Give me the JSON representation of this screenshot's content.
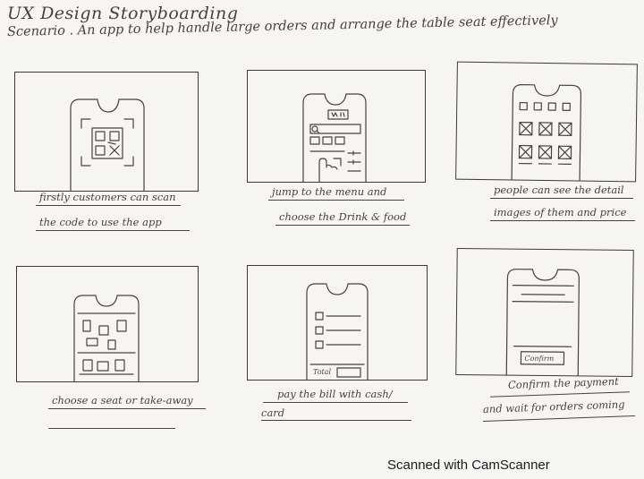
{
  "header": {
    "title": "UX Design Storyboarding",
    "scenario": "Scenario . An app to help handle large orders and arrange the table seat effectively"
  },
  "panels": [
    {
      "caption_line1": "firstly customers can scan",
      "caption_line2": "the code to use the app"
    },
    {
      "caption_line1": "jump to the menu and",
      "caption_line2": "choose the Drink & food"
    },
    {
      "caption_line1": "people can see the detail",
      "caption_line2": "images of them and price"
    },
    {
      "caption_line1": "choose a seat or take-away",
      "caption_line2": ""
    },
    {
      "caption_line1": "pay the bill with cash/",
      "caption_line2": "card",
      "sketch_label": "Total"
    },
    {
      "caption_line1": "Confirm the payment",
      "caption_line2": "and wait for orders coming",
      "sketch_label": "Confirm"
    }
  ],
  "footer": {
    "watermark": "Scanned with CamScanner"
  }
}
